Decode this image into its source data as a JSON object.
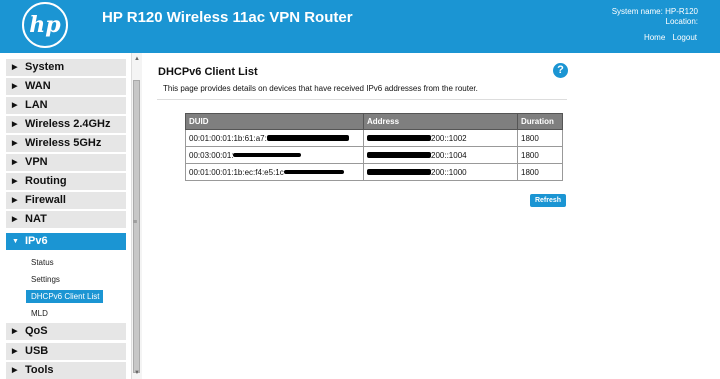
{
  "header": {
    "logo_text": "hp",
    "title": "HP R120 Wireless 11ac VPN Router",
    "system_name_label": "System name:",
    "system_name": "HP-R120",
    "location_label": "Location:",
    "links": [
      "Home",
      "Logout"
    ]
  },
  "sidebar": {
    "items": [
      {
        "label": "System"
      },
      {
        "label": "WAN"
      },
      {
        "label": "LAN"
      },
      {
        "label": "Wireless 2.4GHz"
      },
      {
        "label": "Wireless 5GHz"
      },
      {
        "label": "VPN"
      },
      {
        "label": "Routing"
      },
      {
        "label": "Firewall"
      },
      {
        "label": "NAT"
      },
      {
        "label": "IPv6",
        "active": true
      },
      {
        "label": "QoS"
      },
      {
        "label": "USB"
      },
      {
        "label": "Tools"
      }
    ],
    "submenu": [
      "Status",
      "Settings",
      "DHCPv6 Client List",
      "MLD"
    ],
    "selected_submenu": "DHCPv6 Client List"
  },
  "main": {
    "title": "DHCPv6 Client List",
    "description": "This page provides details on devices that have received IPv6 addresses from the router.",
    "table": {
      "headers": [
        "DUID",
        "Address",
        "Duration"
      ],
      "rows": [
        {
          "duid": "00:01:00:01:1b:61:a7:",
          "address": "200::1002",
          "duration": "1800"
        },
        {
          "duid": "00:03:00:01:",
          "address": "200::1004",
          "duration": "1800"
        },
        {
          "duid": "00:01:00:01:1b:ec:f4:e5:1c",
          "address": "200::1000",
          "duration": "1800"
        }
      ]
    },
    "refresh_label": "Refresh"
  },
  "colors": {
    "accent": "#1b95d3",
    "table_header": "#7f7f7f",
    "menu_bg": "#e6e6e6"
  }
}
